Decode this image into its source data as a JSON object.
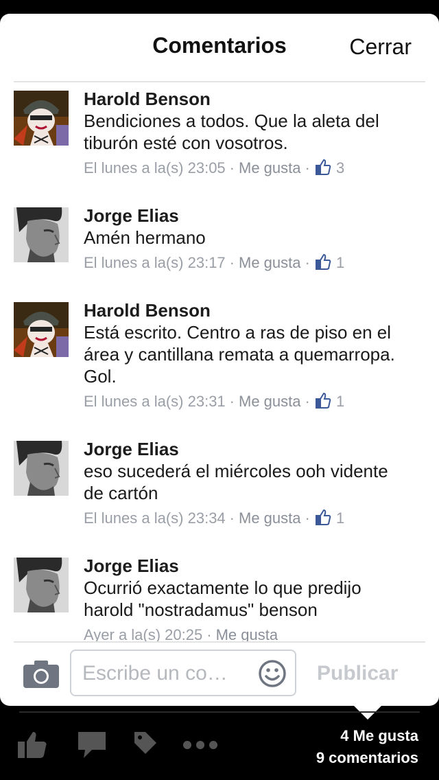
{
  "header": {
    "title": "Comentarios",
    "close_label": "Cerrar"
  },
  "comments": [
    {
      "author": "Harold Benson",
      "avatar": "soldier-cartoon-avatar",
      "lines": [
        "Bendiciones a todos. Que la aleta del",
        "tiburón esté con vosotros."
      ],
      "time": "El lunes a la(s) 23:05",
      "like_label": "Me gusta",
      "likes": "3"
    },
    {
      "author": "Jorge Elias",
      "avatar": "man-profile-photo",
      "lines": [
        "Amén hermano"
      ],
      "time": "El lunes a la(s) 23:17",
      "like_label": "Me gusta",
      "likes": "1"
    },
    {
      "author": "Harold Benson",
      "avatar": "soldier-cartoon-avatar",
      "lines": [
        "Está escrito. Centro a ras de piso en el",
        "área y cantillana remata a quemarropa.",
        "Gol."
      ],
      "time": "El lunes a la(s) 23:31",
      "like_label": "Me gusta",
      "likes": "1"
    },
    {
      "author": "Jorge Elias",
      "avatar": "man-profile-photo",
      "lines": [
        "eso sucederá el miércoles ooh vidente",
        "de cartón"
      ],
      "time": "El lunes a la(s) 23:34",
      "like_label": "Me gusta",
      "likes": "1"
    },
    {
      "author": "Jorge Elias",
      "avatar": "man-profile-photo",
      "lines": [
        "Ocurrió exactamente lo que predijo",
        "harold \"nostradamus\" benson"
      ],
      "time": "Ayer a la(s) 20:25",
      "like_label": "Me gusta",
      "likes": ""
    }
  ],
  "composer": {
    "placeholder": "Escribe un co…",
    "publish_label": "Publicar",
    "camera_icon": "camera-icon",
    "emoji_icon": "smiley-icon"
  },
  "toolbar": {
    "icons": [
      "like-icon",
      "comment-icon",
      "tag-icon",
      "more-icon"
    ],
    "likes_count": "4 Me gusta",
    "comments_count": "9 comentarios"
  },
  "colors": {
    "accent": "#3b5998",
    "meta": "#9a9ea6",
    "placeholder": "#b5b8bd"
  }
}
